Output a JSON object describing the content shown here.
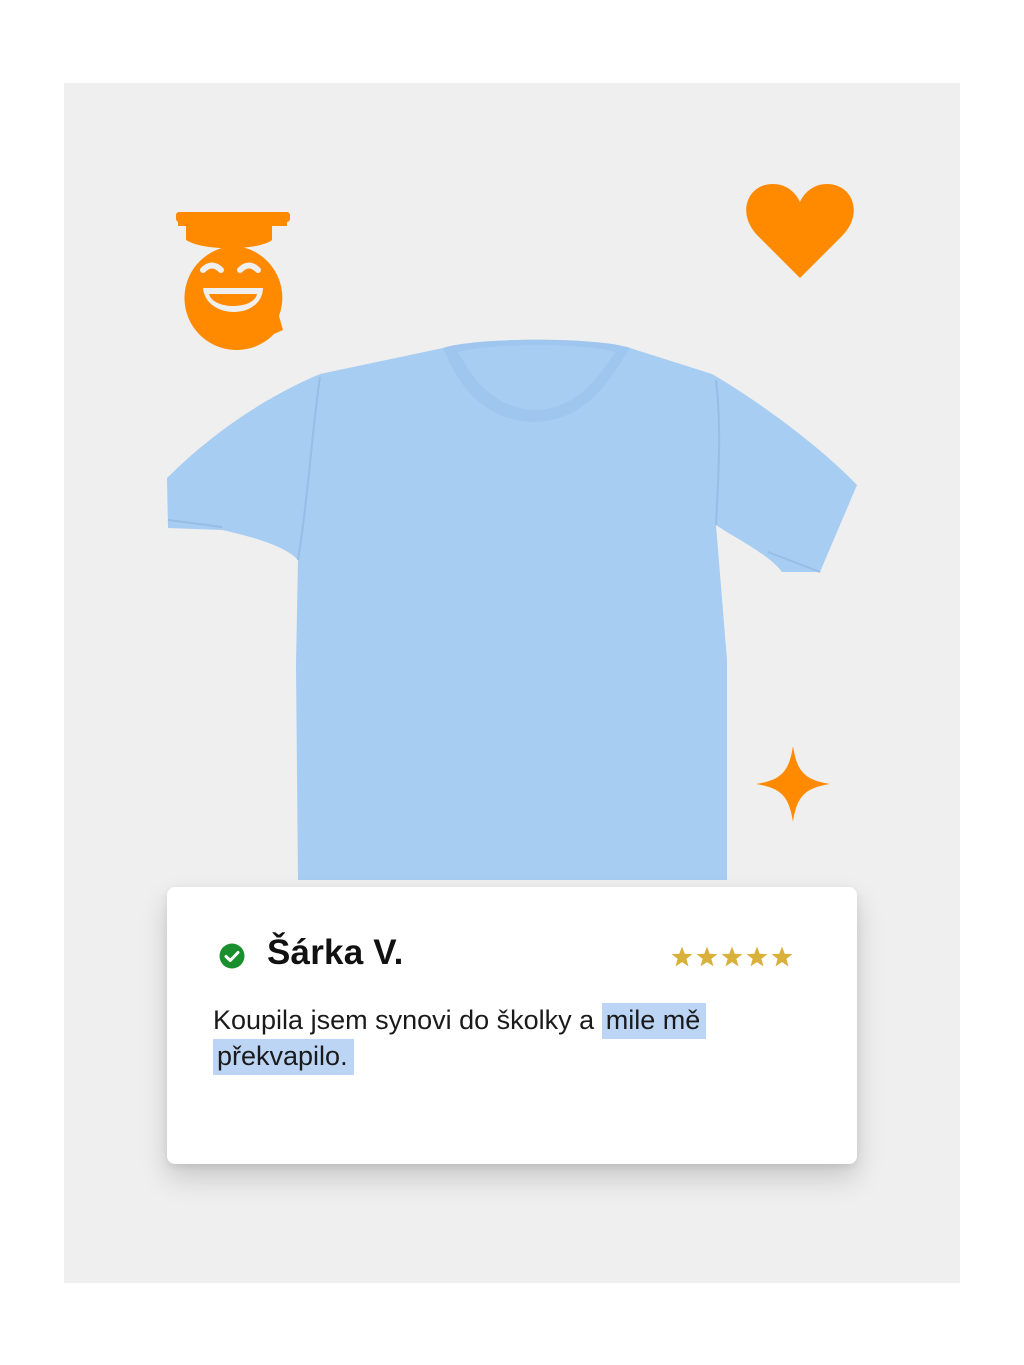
{
  "review": {
    "reviewer_name": "Šárka V.",
    "verified": true,
    "rating": 5,
    "rating_max": 5,
    "text_plain": "Koupila jsem synovi do školky a",
    "text_highlight_1": "mile mě",
    "text_highlight_2": "překvapilo."
  },
  "product": {
    "image": "kids-tshirt-light-blue",
    "color": "#a7cdf2"
  },
  "decorations": {
    "icons": [
      "graduation-smiley-icon",
      "heart-icon",
      "sparkle-icon"
    ],
    "accent_color": "#ff8a00"
  },
  "colors": {
    "background": "#efefef",
    "verified_green": "#1a8f2e",
    "star_gold": "#d9b03a",
    "highlight": "#bcd5f5"
  }
}
